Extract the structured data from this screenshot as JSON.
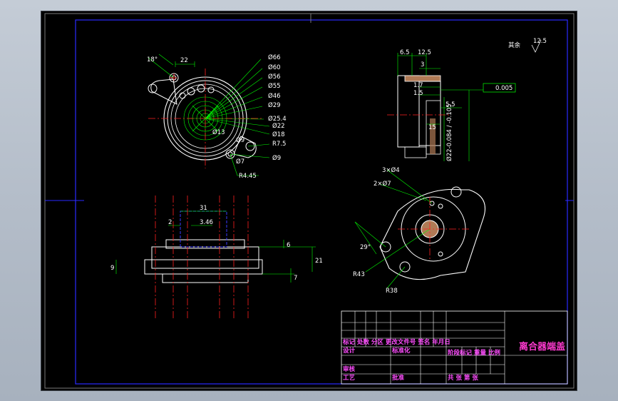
{
  "drawing": {
    "surface_finish": "其余",
    "surface_finish_value": "12.5",
    "front_view": {
      "labels": {
        "angle": "18°",
        "width_22": "22",
        "phi66": "Ø66",
        "phi60": "Ø60",
        "phi56": "Ø56",
        "phi55": "Ø55",
        "phi46": "Ø46",
        "phi29": "Ø29",
        "phi25_4": "Ø25.4",
        "phi22": "Ø22",
        "phi18": "Ø18",
        "phi13": "Ø13",
        "phi9a": "Ø9",
        "phi9b": "Ø9",
        "phi7": "Ø7",
        "r7_5": "R7.5",
        "r4_45": "R4.45"
      }
    },
    "side_view": {
      "labels": {
        "d6_5": "6.5",
        "d12_5": "12.5",
        "d3": "3",
        "d1_7": "1.7",
        "d1_5": "1.5",
        "d5_5": "5.5",
        "d15": "15",
        "tol_phi22": "Ø22-0.084 / -0.105",
        "parallelism": "0.005"
      }
    },
    "section_view": {
      "labels": {
        "d31": "31",
        "d2": "2",
        "d3_46": "3.46",
        "d6": "6",
        "d21": "21",
        "d9": "9",
        "d7": "7"
      }
    },
    "iso_view": {
      "labels": {
        "holes_3x4": "3×Ø4",
        "holes_2x7": "2×Ø7",
        "angle_29": "29°",
        "r43": "R43",
        "r38": "R38"
      }
    },
    "title_block": {
      "row_a": "标记 处数 分区 更改文件号 签名 年月日",
      "row_b_designer": "设计",
      "row_b_std": "标准化",
      "row_c": "审核",
      "row_d": "工艺",
      "row_d_approve": "批准",
      "stage": "阶段标记 重量 比例",
      "sheets": "共 张 第 张",
      "part_name": "离合器端盖"
    }
  },
  "colors": {
    "background": "#000000",
    "outline": "#ffffff",
    "centerline": "#ff2020",
    "dimension": "#00ff00",
    "frame": "#2222ff",
    "hidden": "#3a3aff",
    "annotation": "#ff44ff"
  }
}
